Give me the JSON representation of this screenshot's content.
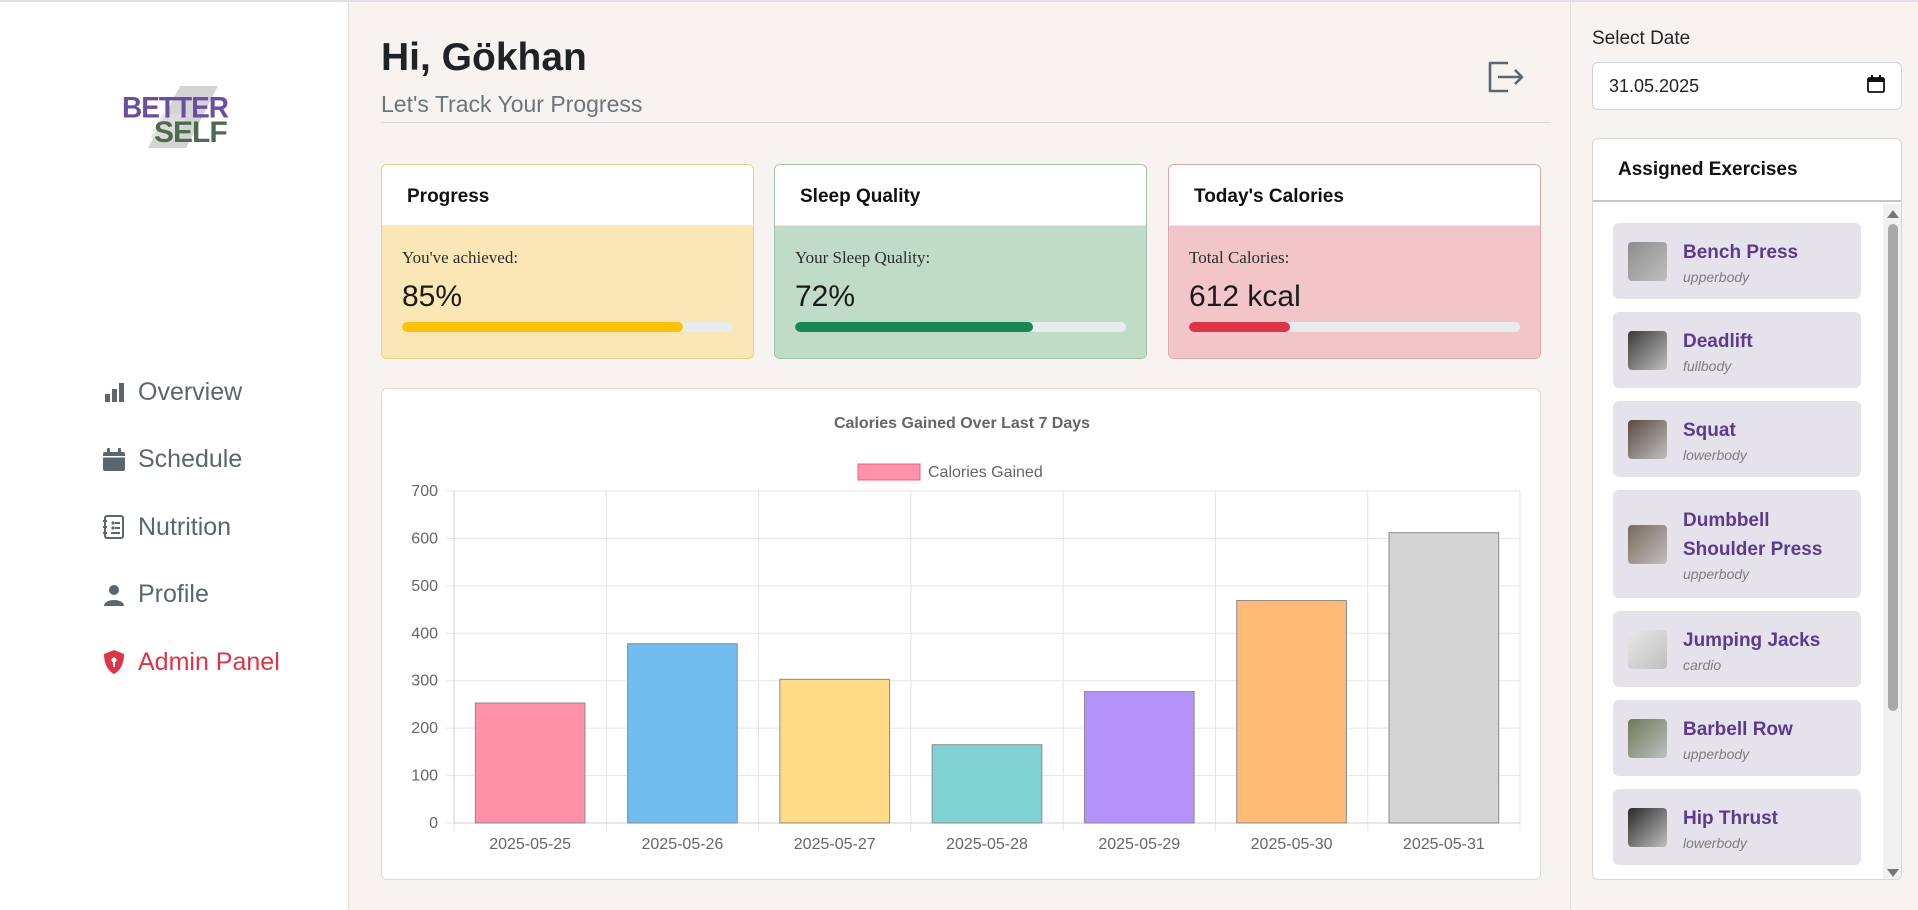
{
  "logo": {
    "line1": "BETTER",
    "line2": "SELF"
  },
  "sidebar": {
    "items": [
      {
        "label": "Overview",
        "icon": "bar-chart-icon"
      },
      {
        "label": "Schedule",
        "icon": "calendar-icon"
      },
      {
        "label": "Nutrition",
        "icon": "nutrition-list-icon"
      },
      {
        "label": "Profile",
        "icon": "person-icon"
      },
      {
        "label": "Admin Panel",
        "icon": "shield-icon"
      }
    ]
  },
  "header": {
    "greeting": "Hi, Gökhan",
    "subtitle": "Let's Track Your Progress"
  },
  "cards": [
    {
      "title": "Progress",
      "label": "You've achieved:",
      "value": "85%",
      "percent": 85,
      "color": "#ffc107",
      "bg": "#fbe7b6",
      "border": "#e7cf8d"
    },
    {
      "title": "Sleep Quality",
      "label": "Your Sleep Quality:",
      "value": "72%",
      "percent": 72,
      "color": "#198754",
      "bg": "#c1dbc9",
      "border": "#9dc3a9"
    },
    {
      "title": "Today's Calories",
      "label": "Total Calories:",
      "value": "612 kcal",
      "percent": 30.6,
      "color": "#dc3545",
      "bg": "#f2c6c8",
      "border": "#dfa5a9"
    }
  ],
  "chart_data": {
    "type": "bar",
    "title": "Calories Gained Over Last 7 Days",
    "categories": [
      "2025-05-25",
      "2025-05-26",
      "2025-05-27",
      "2025-05-28",
      "2025-05-29",
      "2025-05-30",
      "2025-05-31"
    ],
    "series": [
      {
        "name": "Calories Gained",
        "values": [
          253,
          378,
          303,
          165,
          277,
          469,
          612
        ]
      }
    ],
    "colors": [
      "#ff91a9",
      "#72bdef",
      "#ffdb86",
      "#80d3d2",
      "#b592fa",
      "#ffbb77",
      "#d4d4d4"
    ],
    "ylim": [
      0,
      700
    ],
    "yticks": [
      0,
      100,
      200,
      300,
      400,
      500,
      600,
      700
    ],
    "grid": true,
    "legend": "top"
  },
  "right": {
    "select_label": "Select Date",
    "date_value": "31.05.2025",
    "panel_title": "Assigned Exercises",
    "exercises": [
      {
        "name": "Bench Press",
        "category": "upperbody"
      },
      {
        "name": "Deadlift",
        "category": "fullbody"
      },
      {
        "name": "Squat",
        "category": "lowerbody"
      },
      {
        "name": "Dumbbell Shoulder Press",
        "category": "upperbody"
      },
      {
        "name": "Jumping Jacks",
        "category": "cardio"
      },
      {
        "name": "Barbell Row",
        "category": "upperbody"
      },
      {
        "name": "Hip Thrust",
        "category": "lowerbody"
      }
    ]
  }
}
